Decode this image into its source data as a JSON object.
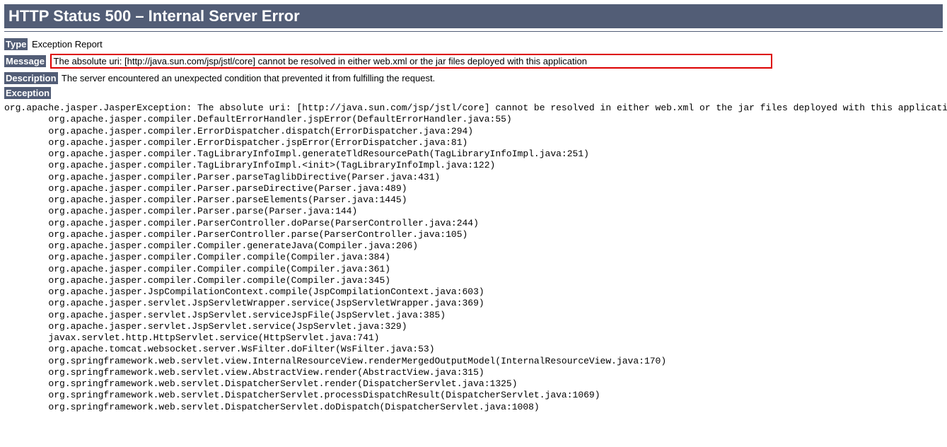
{
  "title": "HTTP Status 500 – Internal Server Error",
  "type": {
    "label": "Type",
    "value": "Exception Report"
  },
  "message": {
    "label": "Message",
    "value": "The absolute uri: [http://java.sun.com/jsp/jstl/core] cannot be resolved in either web.xml or the jar files deployed with this application"
  },
  "description": {
    "label": "Description",
    "value": "The server encountered an unexpected condition that prevented it from fulfilling the request."
  },
  "exception": {
    "label": "Exception"
  },
  "stacktrace": "org.apache.jasper.JasperException: The absolute uri: [http://java.sun.com/jsp/jstl/core] cannot be resolved in either web.xml or the jar files deployed with this application\n        org.apache.jasper.compiler.DefaultErrorHandler.jspError(DefaultErrorHandler.java:55)\n        org.apache.jasper.compiler.ErrorDispatcher.dispatch(ErrorDispatcher.java:294)\n        org.apache.jasper.compiler.ErrorDispatcher.jspError(ErrorDispatcher.java:81)\n        org.apache.jasper.compiler.TagLibraryInfoImpl.generateTldResourcePath(TagLibraryInfoImpl.java:251)\n        org.apache.jasper.compiler.TagLibraryInfoImpl.<init>(TagLibraryInfoImpl.java:122)\n        org.apache.jasper.compiler.Parser.parseTaglibDirective(Parser.java:431)\n        org.apache.jasper.compiler.Parser.parseDirective(Parser.java:489)\n        org.apache.jasper.compiler.Parser.parseElements(Parser.java:1445)\n        org.apache.jasper.compiler.Parser.parse(Parser.java:144)\n        org.apache.jasper.compiler.ParserController.doParse(ParserController.java:244)\n        org.apache.jasper.compiler.ParserController.parse(ParserController.java:105)\n        org.apache.jasper.compiler.Compiler.generateJava(Compiler.java:206)\n        org.apache.jasper.compiler.Compiler.compile(Compiler.java:384)\n        org.apache.jasper.compiler.Compiler.compile(Compiler.java:361)\n        org.apache.jasper.compiler.Compiler.compile(Compiler.java:345)\n        org.apache.jasper.JspCompilationContext.compile(JspCompilationContext.java:603)\n        org.apache.jasper.servlet.JspServletWrapper.service(JspServletWrapper.java:369)\n        org.apache.jasper.servlet.JspServlet.serviceJspFile(JspServlet.java:385)\n        org.apache.jasper.servlet.JspServlet.service(JspServlet.java:329)\n        javax.servlet.http.HttpServlet.service(HttpServlet.java:741)\n        org.apache.tomcat.websocket.server.WsFilter.doFilter(WsFilter.java:53)\n        org.springframework.web.servlet.view.InternalResourceView.renderMergedOutputModel(InternalResourceView.java:170)\n        org.springframework.web.servlet.view.AbstractView.render(AbstractView.java:315)\n        org.springframework.web.servlet.DispatcherServlet.render(DispatcherServlet.java:1325)\n        org.springframework.web.servlet.DispatcherServlet.processDispatchResult(DispatcherServlet.java:1069)\n        org.springframework.web.servlet.DispatcherServlet.doDispatch(DispatcherServlet.java:1008)"
}
